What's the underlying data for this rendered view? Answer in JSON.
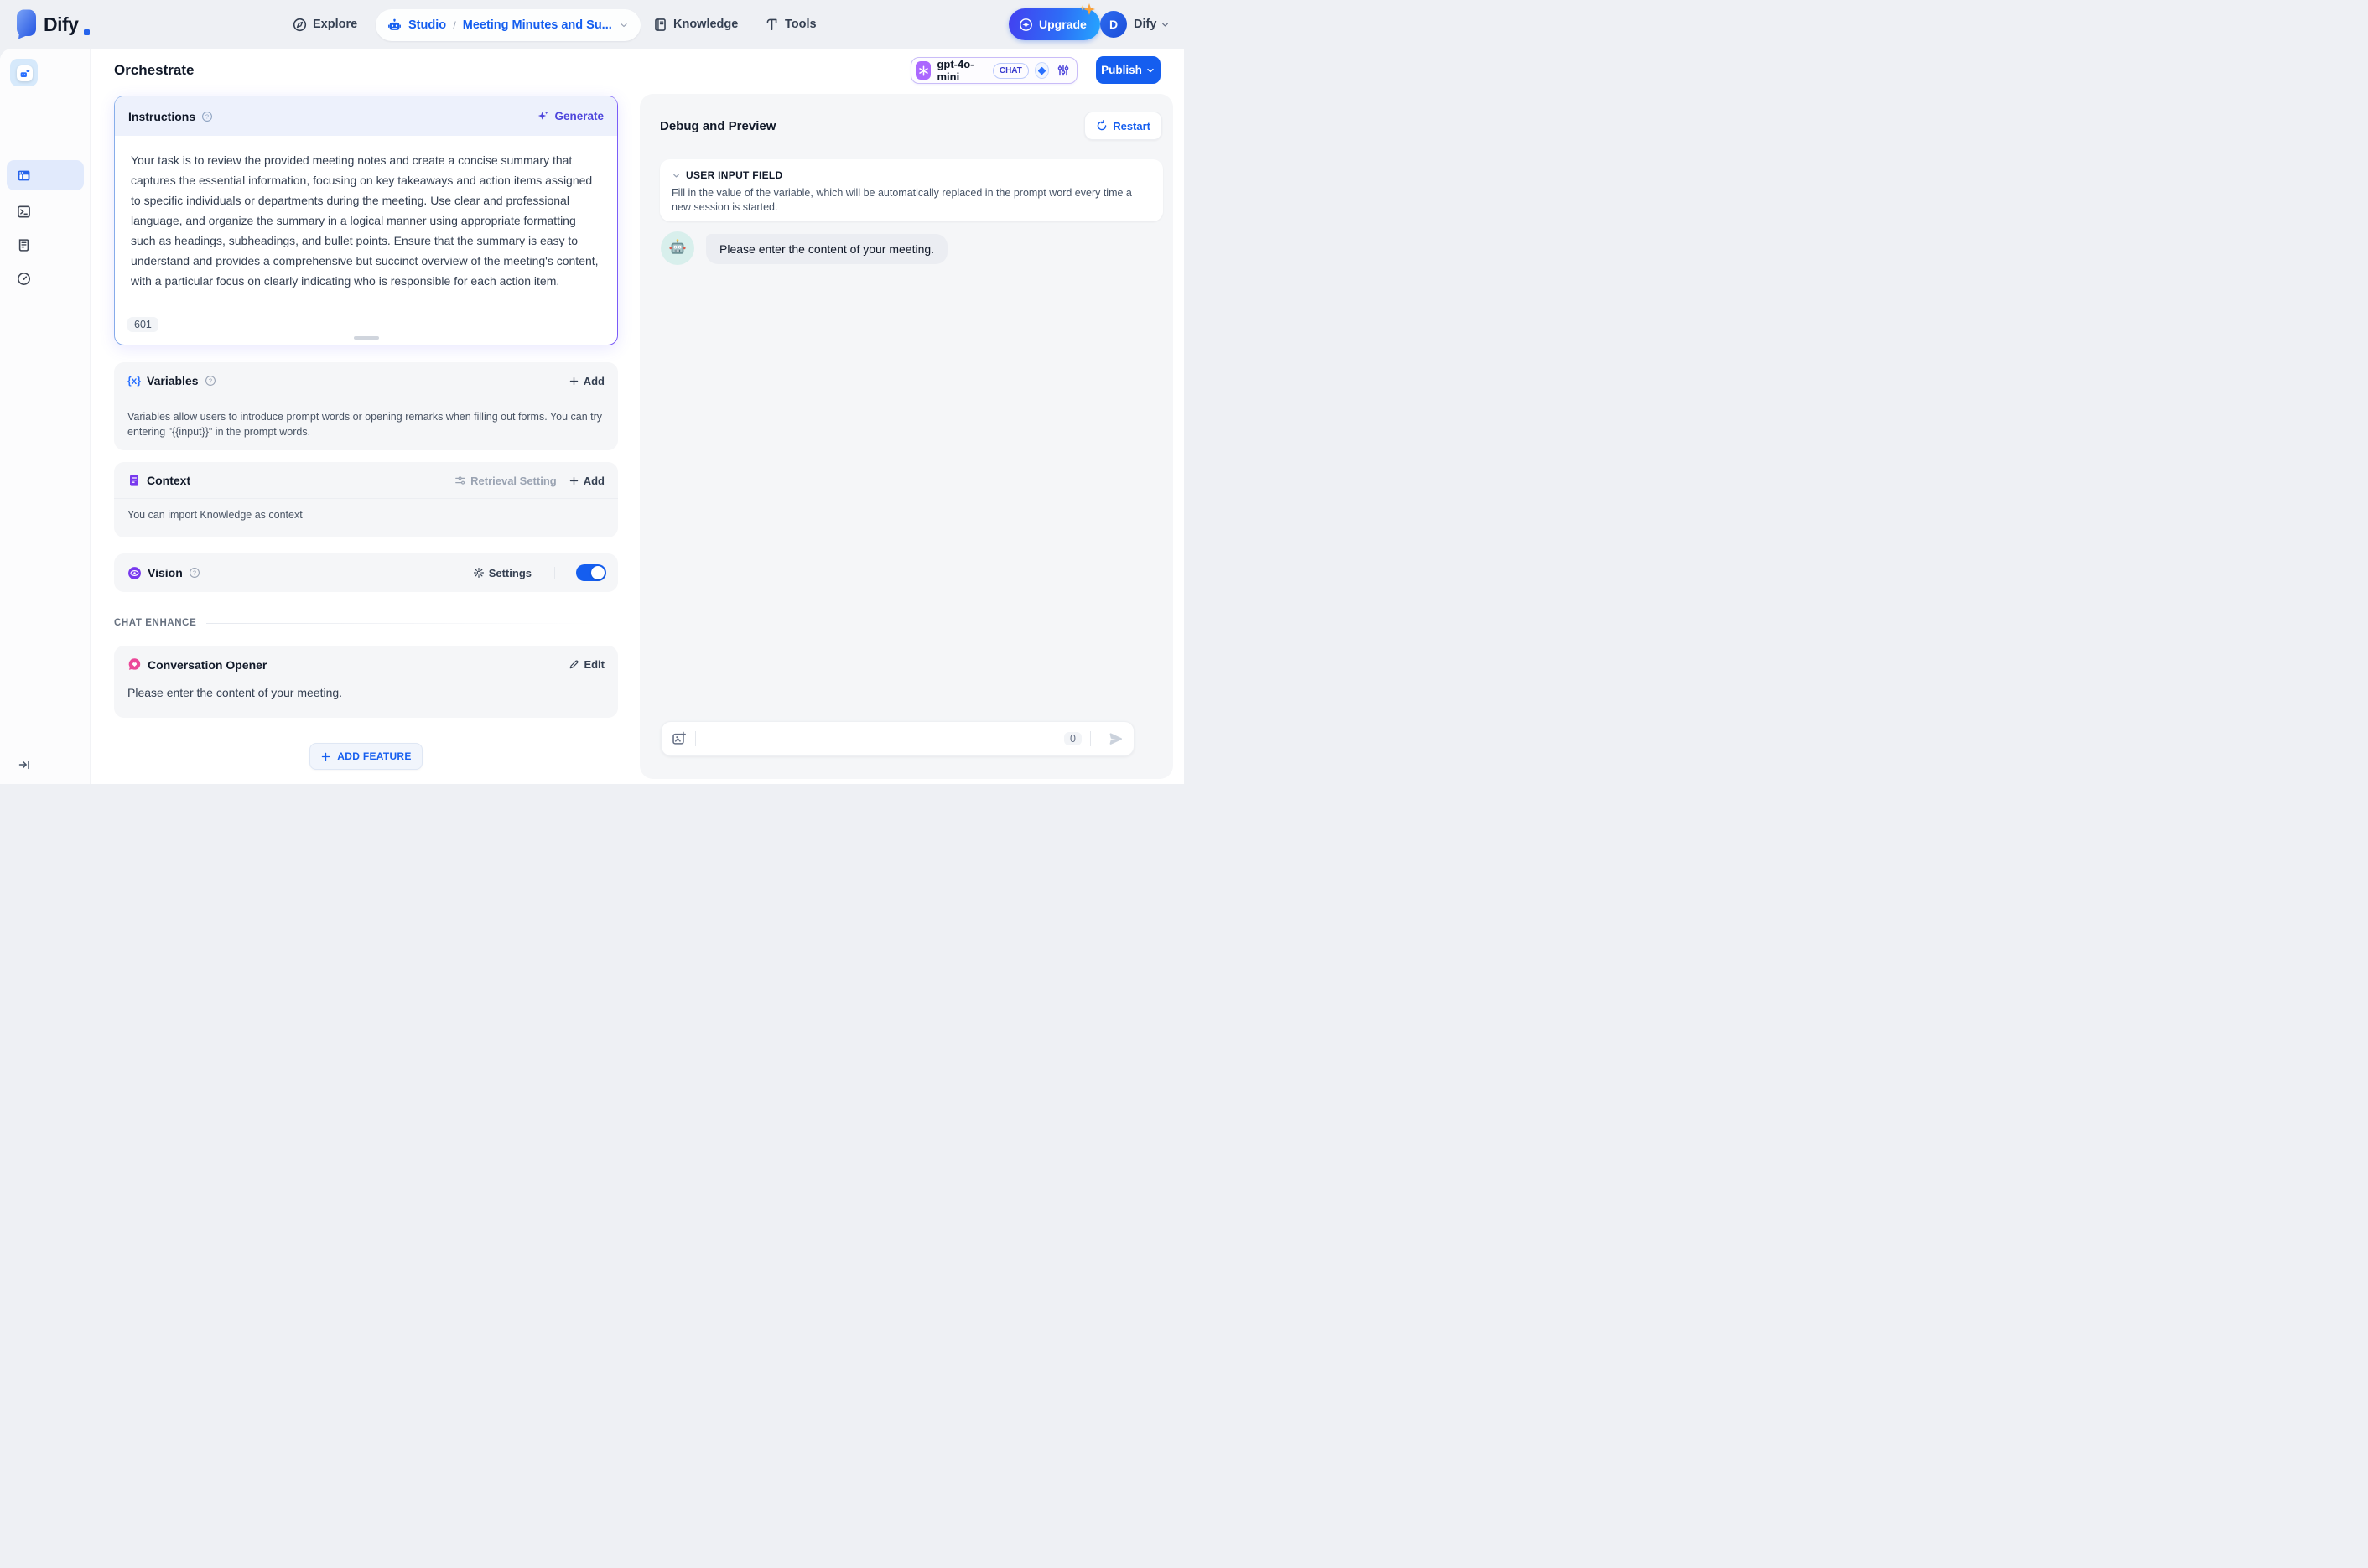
{
  "colors": {
    "accent_blue": "#155eef",
    "indigo_accent": "#4e46dc",
    "purple_accent": "#7839ee",
    "pink_accent": "#ec4899",
    "model_icon_bg": "#ab68ff",
    "toggle_on": "#155eef"
  },
  "nav": {
    "logo": "Dify",
    "explore": "Explore",
    "studio": "Studio",
    "separator": "/",
    "app_name": "Meeting Minutes and Su...",
    "knowledge": "Knowledge",
    "tools": "Tools",
    "upgrade": "Upgrade",
    "avatar_initial": "D",
    "account": "Dify"
  },
  "header": {
    "title": "Orchestrate",
    "model": {
      "name": "gpt-4o-mini",
      "mode": "CHAT"
    },
    "publish": "Publish"
  },
  "instructions": {
    "title": "Instructions",
    "generate": "Generate",
    "text": "Your task is to review the provided meeting notes and create a concise summary that captures the essential information, focusing on key takeaways and action items assigned to specific individuals or departments during the meeting. Use clear and professional language, and organize the summary in a logical manner using appropriate formatting such as headings, subheadings, and bullet points. Ensure that the summary is easy to understand and provides a comprehensive but succinct overview of the meeting's content, with a particular focus on clearly indicating who is responsible for each action item.",
    "char_count": "601"
  },
  "variables": {
    "title": "Variables",
    "add": "Add",
    "description": "Variables allow users to introduce prompt words or opening remarks when filling out forms. You can try entering \"{{input}}\" in the prompt words."
  },
  "context": {
    "title": "Context",
    "retrieval_setting": "Retrieval Setting",
    "add": "Add",
    "description": "You can import Knowledge as context"
  },
  "vision": {
    "title": "Vision",
    "settings": "Settings",
    "enabled": true
  },
  "sections": {
    "chat_enhance": "CHAT ENHANCE"
  },
  "opener": {
    "title": "Conversation Opener",
    "edit": "Edit",
    "text": "Please enter the content of your meeting."
  },
  "add_feature_label": "ADD FEATURE",
  "debug": {
    "title": "Debug and Preview",
    "restart": "Restart",
    "user_input_field": {
      "title": "USER INPUT FIELD",
      "description": "Fill in the value of the variable, which will be automatically replaced in the prompt word every time a new session is started."
    },
    "message": {
      "text": "Please enter the content of your meeting."
    },
    "input": {
      "char_count": "0"
    }
  }
}
